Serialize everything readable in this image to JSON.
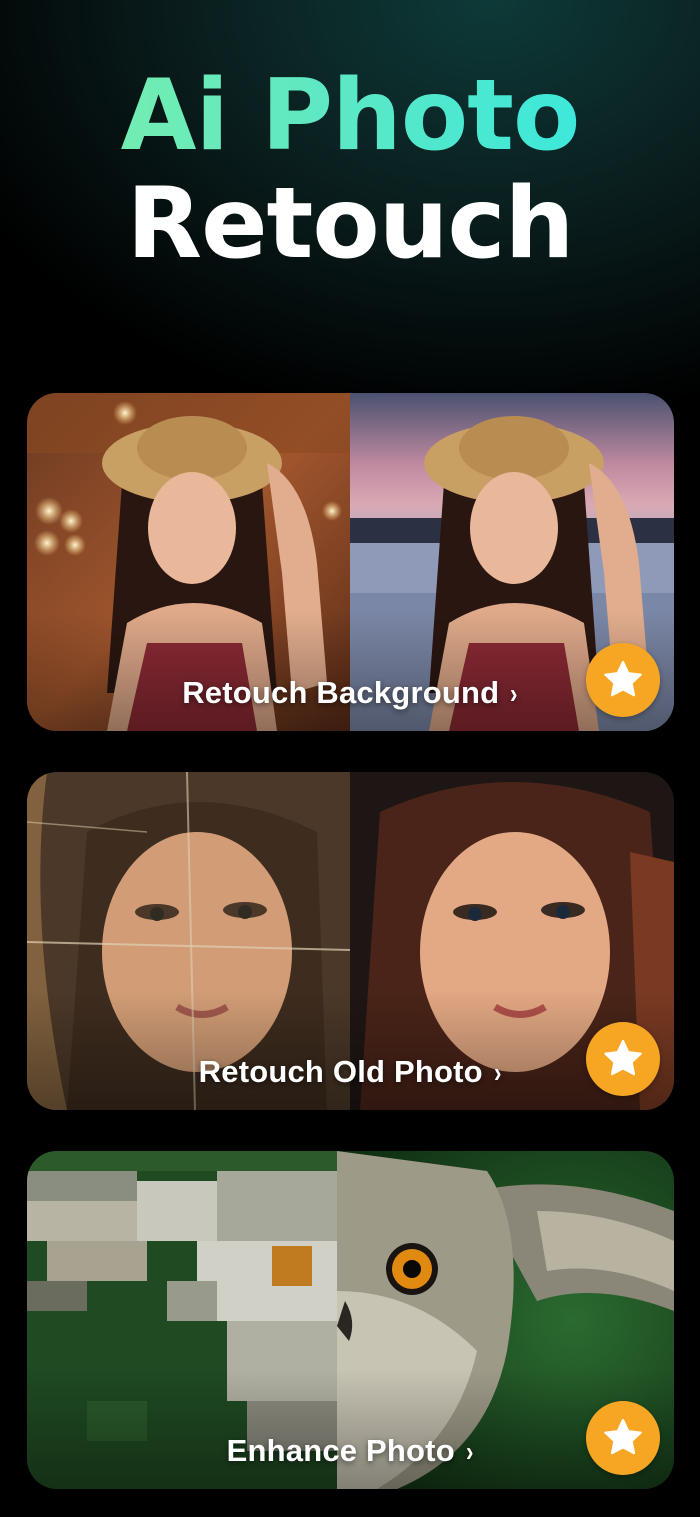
{
  "header": {
    "title_line1": "Ai Photo",
    "title_line2": "Retouch"
  },
  "colors": {
    "title_gradient_start": "#7ef0a8",
    "title_gradient_end": "#2de8e6",
    "badge": "#f6a623",
    "background": "#000000"
  },
  "cards": [
    {
      "label": "Retouch Background",
      "chevron": "›",
      "badge_icon": "star-icon"
    },
    {
      "label": "Retouch Old Photo",
      "chevron": "›",
      "badge_icon": "star-icon"
    },
    {
      "label": "Enhance Photo",
      "chevron": "›",
      "badge_icon": "star-icon"
    }
  ]
}
